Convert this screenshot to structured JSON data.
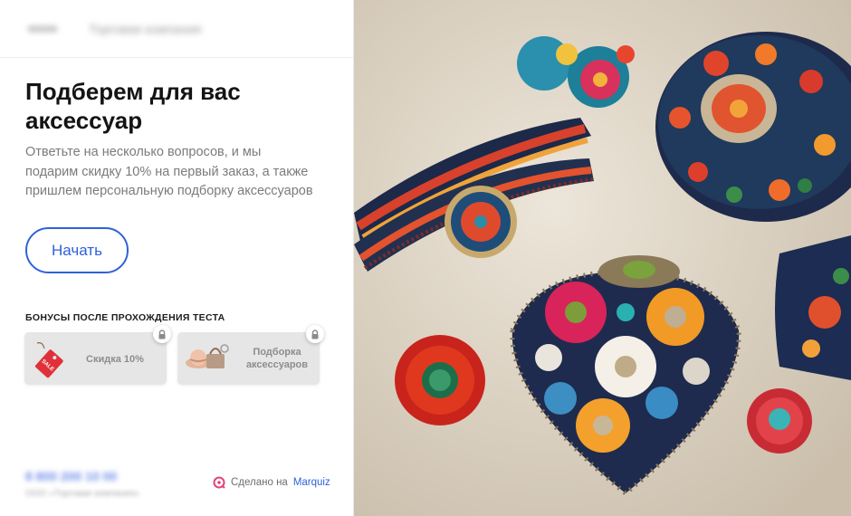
{
  "header": {
    "company_name": "Торговая компания"
  },
  "main": {
    "title": "Подберем для вас аксессуар",
    "description": "Ответьте на несколько вопросов, и мы подарим скидку 10% на первый заказ, а также пришлем персональную подборку аксессуаров",
    "start_button": "Начать"
  },
  "bonuses": {
    "title": "БОНУСЫ ПОСЛЕ ПРОХОЖДЕНИЯ ТЕСТА",
    "items": [
      {
        "label": "Скидка 10%",
        "icon": "sale-tag-icon",
        "tag_text": "SALE"
      },
      {
        "label": "Подборка аксессуаров",
        "icon": "accessories-icon"
      }
    ]
  },
  "footer": {
    "phone": "8 800 200 10 00",
    "copyright": "ООО «Торговая компания»",
    "made_by_prefix": "Сделано на",
    "made_by_brand": "Marquiz"
  },
  "hero_image": {
    "description_icon": "embroidered-accessories-photo"
  },
  "colors": {
    "accent": "#2f62d9",
    "text_muted": "#7b7b7b",
    "card_bg": "#e6e6e6"
  }
}
